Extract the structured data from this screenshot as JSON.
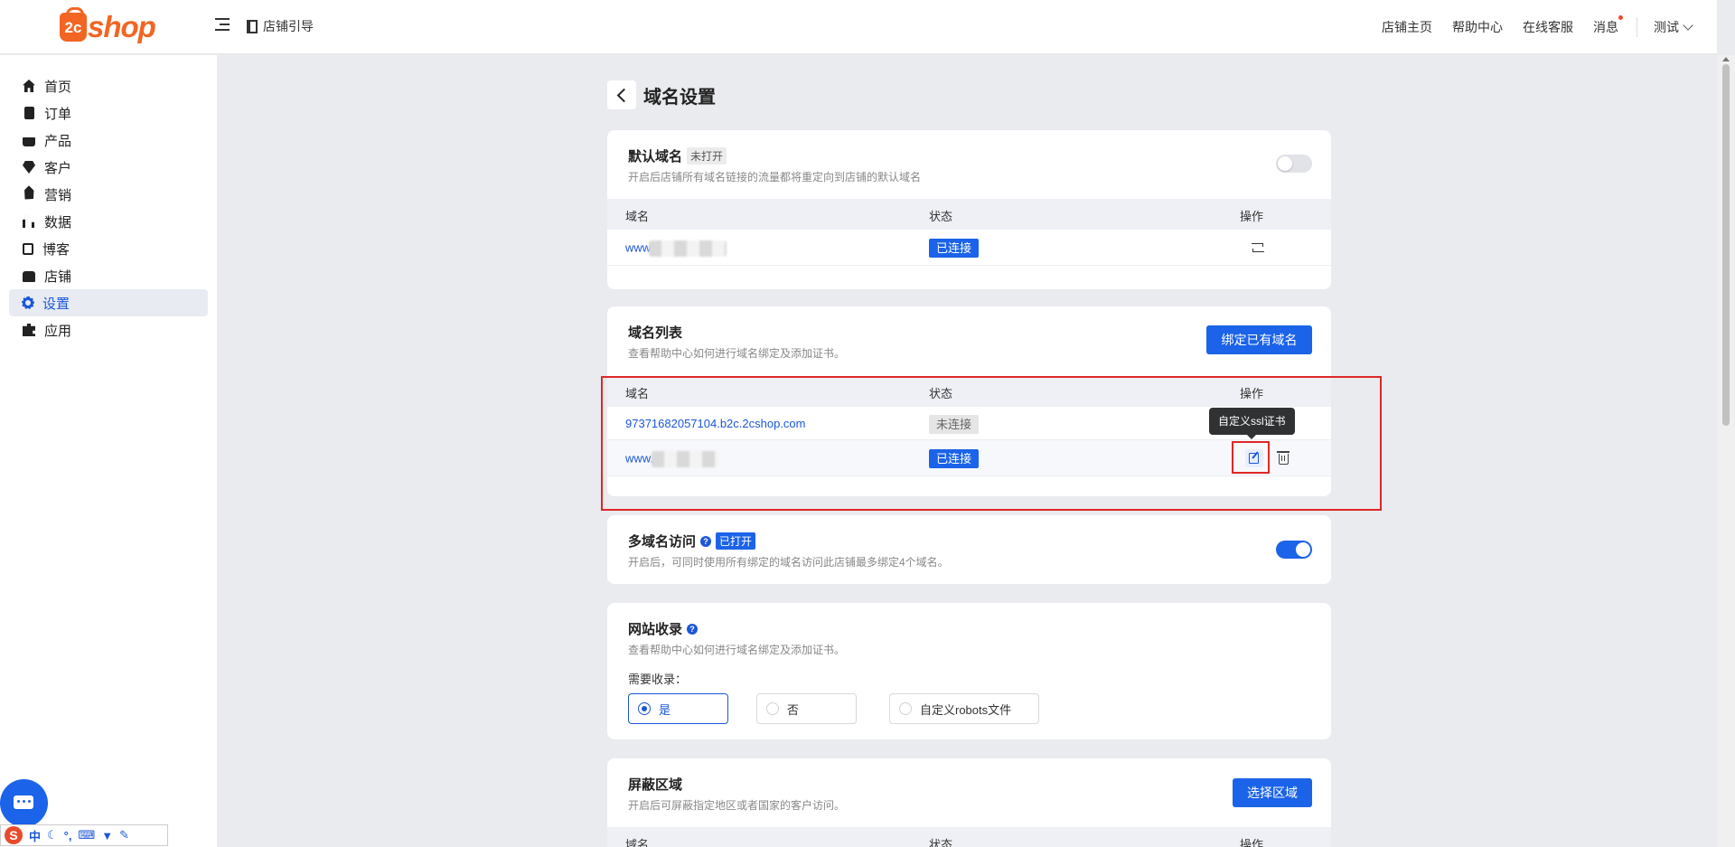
{
  "header": {
    "logo": {
      "badge": "2c",
      "text": "shop"
    },
    "guide_label": "店铺引导",
    "links": [
      "店铺主页",
      "帮助中心",
      "在线客服",
      "消息"
    ],
    "user_label": "测试"
  },
  "sidebar": {
    "items": [
      {
        "label": "首页",
        "icon": "home-icon"
      },
      {
        "label": "订单",
        "icon": "clipboard-icon"
      },
      {
        "label": "产品",
        "icon": "bag-icon"
      },
      {
        "label": "客户",
        "icon": "gem-icon"
      },
      {
        "label": "营销",
        "icon": "tag-icon"
      },
      {
        "label": "数据",
        "icon": "bar-chart-icon"
      },
      {
        "label": "博客",
        "icon": "edit-note-icon"
      },
      {
        "label": "店铺",
        "icon": "store-icon"
      },
      {
        "label": "设置",
        "icon": "gear-icon",
        "active": true
      },
      {
        "label": "应用",
        "icon": "puzzle-icon"
      }
    ]
  },
  "page": {
    "title": "域名设置"
  },
  "default_domain": {
    "title": "默认域名",
    "badge": "未打开",
    "desc": "开启后店铺所有域名链接的流量都将重定向到店铺的默认域名",
    "enabled": false,
    "columns": [
      "域名",
      "状态",
      "操作"
    ],
    "rows": [
      {
        "domain_prefix": "www",
        "status": "已连接"
      }
    ]
  },
  "domain_list": {
    "title": "域名列表",
    "desc": "查看帮助中心如何进行域名绑定及添加证书。",
    "bind_button": "绑定已有域名",
    "columns": [
      "域名",
      "状态",
      "操作"
    ],
    "rows": [
      {
        "domain": "97371682057104.b2c.2cshop.com",
        "status": "未连接"
      },
      {
        "domain_prefix": "www.",
        "status": "已连接"
      }
    ],
    "tooltip": "自定义ssl证书"
  },
  "multi_domain": {
    "title": "多域名访问",
    "badge": "已打开",
    "desc": "开启后，可同时使用所有绑定的域名访问此店铺最多绑定4个域名。",
    "enabled": true
  },
  "site_index": {
    "title": "网站收录",
    "desc": "查看帮助中心如何进行域名绑定及添加证书。",
    "question": "需要收录：",
    "options": [
      "是",
      "否",
      "自定义robots文件"
    ],
    "selected": "是"
  },
  "block_region": {
    "title": "屏蔽区域",
    "desc": "开启后可屏蔽指定地区或者国家的客户访问。",
    "button": "选择区域",
    "columns": [
      "域名",
      "状态",
      "操作"
    ]
  },
  "ime": {
    "badge": "S",
    "mode": "中"
  },
  "colors": {
    "accent": "#1b63e8",
    "brand": "#f26522",
    "highlight": "#e02727"
  }
}
